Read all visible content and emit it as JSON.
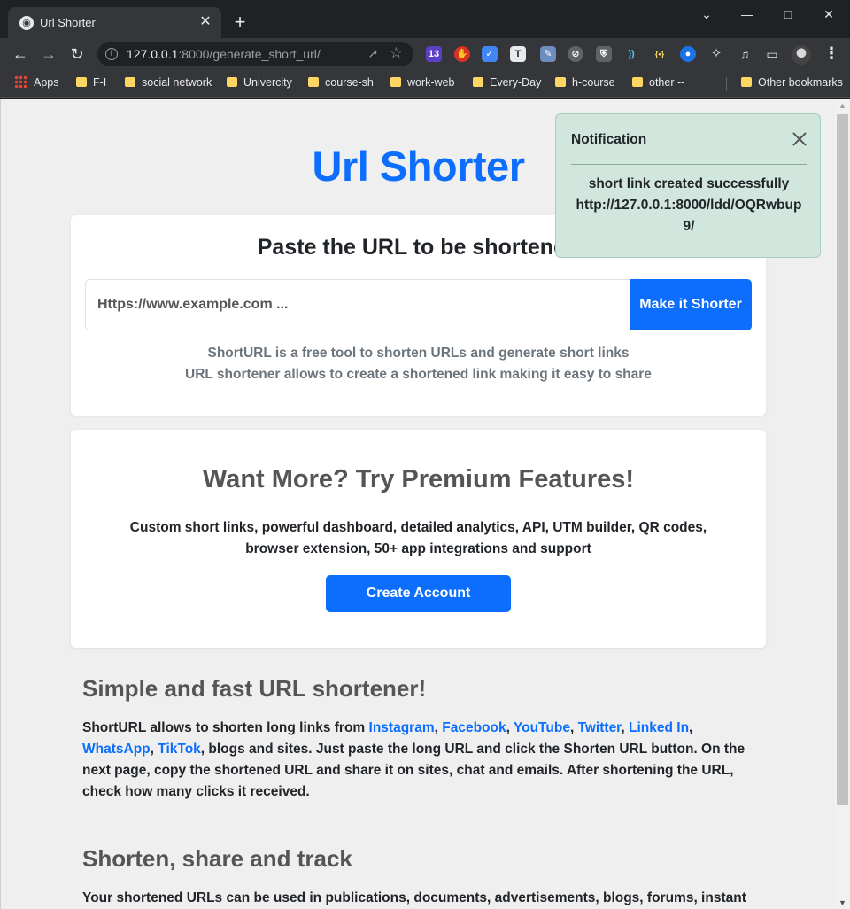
{
  "browser": {
    "tab_title": "Url Shorter",
    "url_host": "127.0.0.1",
    "url_rest": ":8000/generate_short_url/",
    "extension_badge": "13",
    "bookmarks": [
      "Apps",
      "F-I",
      "social network",
      "Univercity",
      "course-sh",
      "work-web",
      "Every-Day",
      "h-course",
      "other --"
    ],
    "other_bookmarks": "Other bookmarks"
  },
  "page": {
    "title": "Url Shorter",
    "form": {
      "heading": "Paste the URL to be shortened",
      "placeholder": "Https://www.example.com ...",
      "button": "Make it Shorter",
      "desc_line1": "ShortURL is a free tool to shorten URLs and generate short links",
      "desc_line2": "URL shortener allows to create a shortened link making it easy to share"
    },
    "premium": {
      "heading": "Want More? Try Premium Features!",
      "text": "Custom short links, powerful dashboard, detailed analytics, API, UTM builder, QR codes, browser extension, 50+ app integrations and support",
      "button": "Create Account"
    },
    "section1": {
      "heading": "Simple and fast URL shortener!",
      "intro": "ShortURL allows to shorten long links from ",
      "links": [
        "Instagram",
        "Facebook",
        "YouTube",
        "Twitter",
        "Linked In",
        "WhatsApp",
        "TikTok"
      ],
      "outro": ", blogs and sites. Just paste the long URL and click the Shorten URL button. On the next page, copy the shortened URL and share it on sites, chat and emails. After shortening the URL, check how many clicks it received."
    },
    "section2": {
      "heading": "Shorten, share and track",
      "text": "Your shortened URLs can be used in publications, documents, advertisements, blogs, forums, instant"
    }
  },
  "notification": {
    "title": "Notification",
    "message": "short link created successfully",
    "short_url": "http://127.0.0.1:8000/ldd/OQRwbup9/"
  },
  "colors": {
    "primary": "#0d6efd",
    "toast_bg": "#d1e7dd",
    "page_bg": "#efefef"
  }
}
